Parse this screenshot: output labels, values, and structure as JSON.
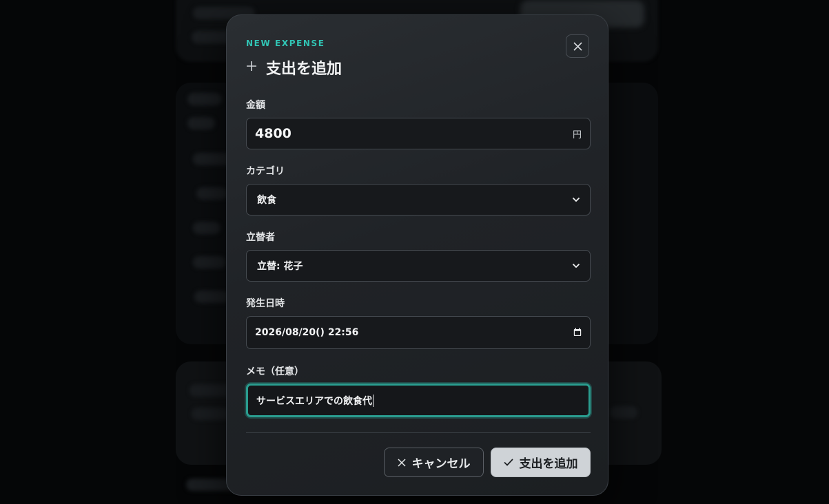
{
  "modal": {
    "eyebrow": "NEW EXPENSE",
    "title": "支出を追加",
    "title_icon": "plus-icon",
    "close_icon": "close-icon"
  },
  "form": {
    "amount": {
      "label": "金額",
      "value": "4800",
      "unit": "円"
    },
    "category": {
      "label": "カテゴリ",
      "selected": "飲食"
    },
    "payer": {
      "label": "立替者",
      "selected": "立替: 花子"
    },
    "datetime": {
      "label": "発生日時",
      "value": "2026/08/20() 22:56",
      "icon": "calendar-icon"
    },
    "memo": {
      "label": "メモ（任意）",
      "value": "サービスエリアでの飲食代"
    }
  },
  "actions": {
    "cancel_label": "キャンセル",
    "submit_label": "支出を追加"
  },
  "colors": {
    "accent": "#31c4b4",
    "focus_border": "#2a9d8f",
    "modal_bg": "#202327",
    "field_bg": "#17191c",
    "submit_bg": "#cfd3d7"
  }
}
